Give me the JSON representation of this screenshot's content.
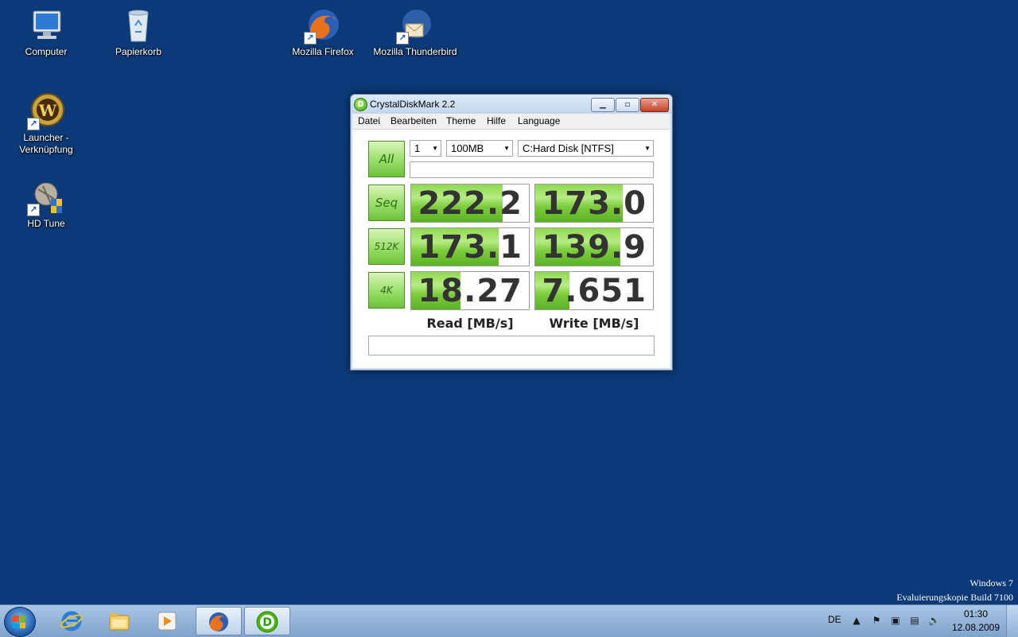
{
  "desktop": {
    "icons": [
      {
        "label": "Computer"
      },
      {
        "label": "Papierkorb"
      },
      {
        "label": "Mozilla Firefox"
      },
      {
        "label": "Mozilla Thunderbird"
      },
      {
        "label": "Launcher -\nVerknüpfung"
      },
      {
        "label": "HD Tune"
      }
    ],
    "watermark_line1": "Windows 7",
    "watermark_line2": "Evaluierungskopie Build 7100"
  },
  "window": {
    "title": "CrystalDiskMark 2.2",
    "menu": [
      "Datei",
      "Bearbeiten",
      "Theme",
      "Hilfe",
      "Language"
    ],
    "controls": {
      "count": "1",
      "size": "100MB",
      "drive": "C:Hard Disk [NTFS]"
    },
    "buttons": {
      "all": "All",
      "seq": "Seq",
      "k512": "512K",
      "k4": "4K"
    },
    "results": {
      "seq_read": "222.2",
      "seq_write": "173.0",
      "k512_read": "173.1",
      "k512_write": "139.9",
      "k4_read": "18.27",
      "k4_write": "7.651"
    },
    "fill_fraction": {
      "seq_read": 0.78,
      "seq_write": 0.74,
      "k512_read": 0.74,
      "k512_write": 0.72,
      "k4_read": 0.42,
      "k4_write": 0.29
    },
    "read_header": "Read [MB/s]",
    "write_header": "Write [MB/s]",
    "accent_green": "#7ccc3c"
  },
  "taskbar": {
    "language": "DE",
    "time": "01:30",
    "date": "12.08.2009"
  }
}
